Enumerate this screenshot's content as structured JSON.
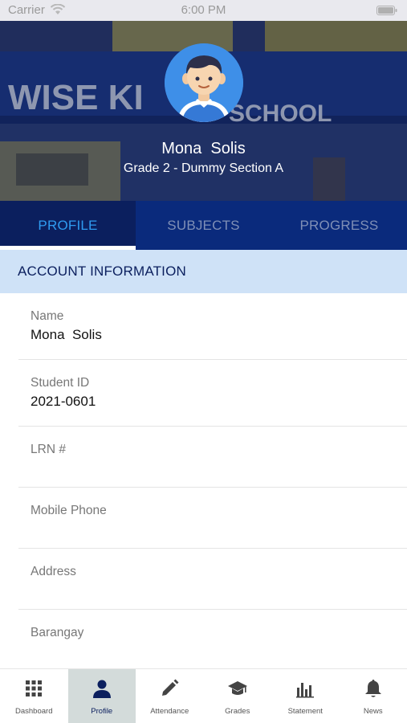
{
  "status_bar": {
    "carrier": "Carrier",
    "time": "6:00 PM"
  },
  "header": {
    "student_name": "Mona  Solis",
    "grade_section": "Grade 2 - Dummy Section A",
    "avatar_icon": "student-avatar-icon",
    "accent": "#3e8fe8"
  },
  "tabs": [
    {
      "label": "PROFILE",
      "active": true
    },
    {
      "label": "SUBJECTS",
      "active": false
    },
    {
      "label": "PROGRESS",
      "active": false
    }
  ],
  "section": {
    "title": "ACCOUNT INFORMATION"
  },
  "fields": [
    {
      "label": "Name",
      "value": "Mona  Solis"
    },
    {
      "label": "Student ID",
      "value": "2021-0601"
    },
    {
      "label": "LRN #",
      "value": ""
    },
    {
      "label": "Mobile Phone",
      "value": ""
    },
    {
      "label": "Address",
      "value": ""
    },
    {
      "label": "Barangay",
      "value": ""
    }
  ],
  "bottom_nav": [
    {
      "label": "Dashboard",
      "icon": "grid-icon",
      "active": false
    },
    {
      "label": "Profile",
      "icon": "person-icon",
      "active": true
    },
    {
      "label": "Attendance",
      "icon": "pencil-icon",
      "active": false
    },
    {
      "label": "Grades",
      "icon": "graduation-cap-icon",
      "active": false
    },
    {
      "label": "Statement",
      "icon": "bar-chart-icon",
      "active": false
    },
    {
      "label": "News",
      "icon": "bell-icon",
      "active": false
    }
  ],
  "colors": {
    "tab_bar": "#0a2a7c",
    "active_tab_text": "#2f9bf0",
    "section_bg": "#cfe2f7",
    "nav_active_bg": "#d3dbda"
  }
}
